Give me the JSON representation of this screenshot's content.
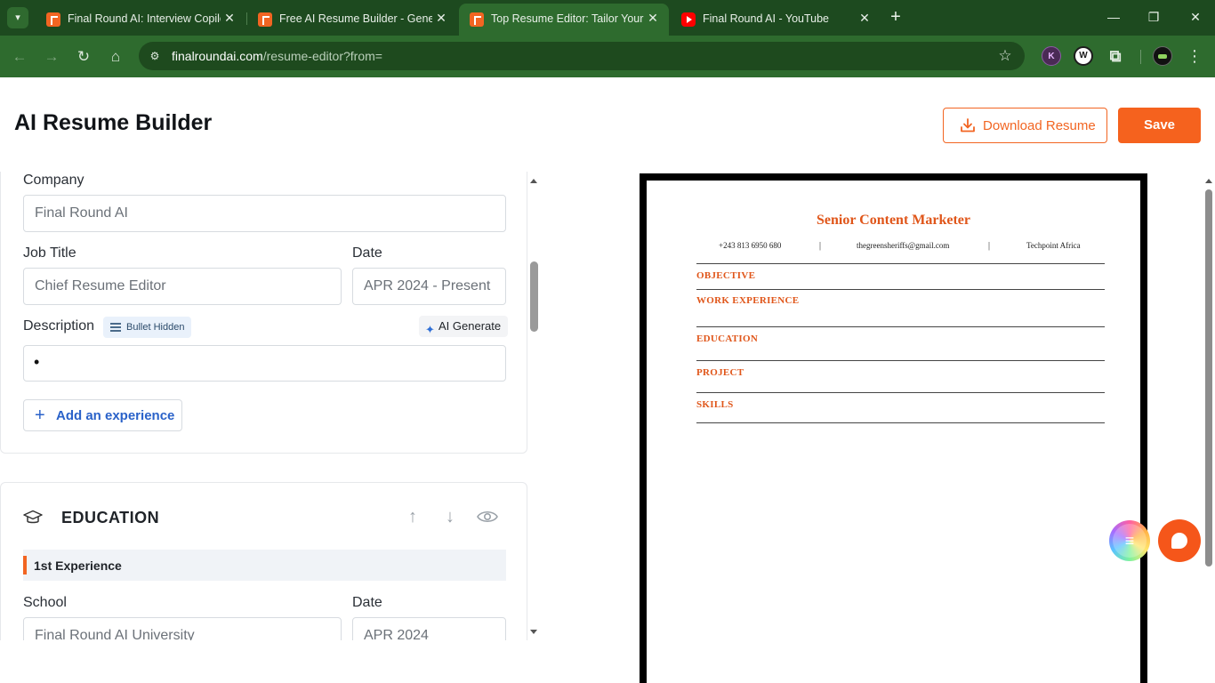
{
  "browser": {
    "tabs": [
      {
        "title": "Final Round AI: Interview Copilot",
        "favicon": "final-round-icon",
        "active": false
      },
      {
        "title": "Free AI Resume Builder - Generator",
        "favicon": "final-round-icon",
        "active": false
      },
      {
        "title": "Top Resume Editor: Tailor Your Resume",
        "favicon": "final-round-icon",
        "active": true
      },
      {
        "title": "Final Round AI - YouTube",
        "favicon": "youtube-icon",
        "active": false
      }
    ],
    "url_host": "finalroundai.com",
    "url_path": "/resume-editor?from=",
    "extensions": {
      "k_label": "K",
      "w_label": "W"
    }
  },
  "header": {
    "title": "AI Resume Builder",
    "download_label": "Download Resume",
    "save_label": "Save"
  },
  "experience": {
    "company_label": "Company",
    "company_placeholder": "Final Round AI",
    "job_title_label": "Job Title",
    "job_title_placeholder": "Chief Resume Editor",
    "date_label": "Date",
    "date_placeholder": "APR 2024 - Present",
    "description_label": "Description",
    "bullet_toggle_label": "Bullet Hidden",
    "ai_generate_label": "AI Generate",
    "description_bullet": "•",
    "add_label": "Add an experience"
  },
  "education": {
    "title": "EDUCATION",
    "entry_label": "1st Experience",
    "school_label": "School",
    "school_placeholder": "Final Round AI University",
    "date_label": "Date",
    "date_placeholder": "APR 2024"
  },
  "preview": {
    "name": "Senior Content Marketer",
    "phone": "+243 813 6950 680",
    "email": "thegreensheriffs@gmail.com",
    "location": "Techpoint Africa",
    "separator": "|",
    "sections": [
      "OBJECTIVE",
      "WORK EXPERIENCE",
      "EDUCATION",
      "PROJECT",
      "SKILLS"
    ]
  },
  "colors": {
    "accent": "#f26522",
    "chrome_dark": "#1d4a1f",
    "chrome_toolbar": "#2e6b2e",
    "link_blue": "#2a62c9"
  }
}
